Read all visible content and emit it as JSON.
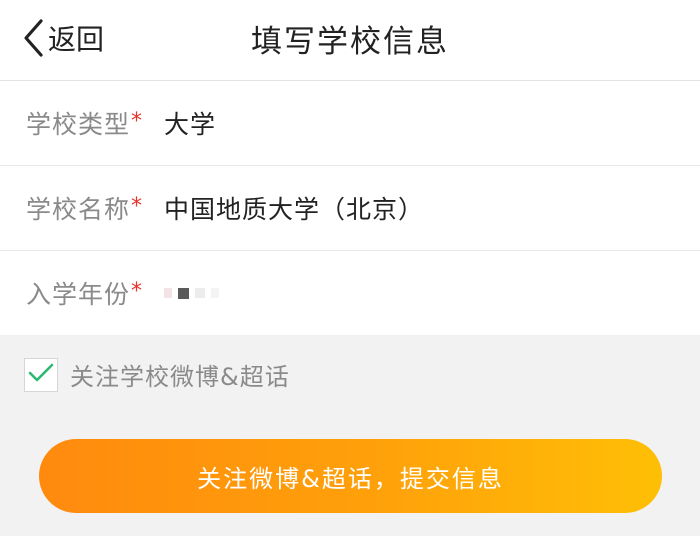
{
  "navbar": {
    "back_label": "返回",
    "title": "填写学校信息"
  },
  "form": {
    "rows": [
      {
        "label": "学校类型",
        "required_mark": "*",
        "value": "大学"
      },
      {
        "label": "学校名称",
        "required_mark": "*",
        "value": "中国地质大学（北京）"
      },
      {
        "label": "入学年份",
        "required_mark": "*",
        "value": ""
      }
    ]
  },
  "follow_checkbox": {
    "checked": true,
    "label": "关注学校微博&超话"
  },
  "submit": {
    "label": "关注微博&超话，提交信息"
  },
  "colors": {
    "accent_start": "#ff8a0e",
    "accent_end": "#ffbf06",
    "required_mark": "#e5322d",
    "check_green": "#2eb872",
    "label_gray": "#8a8a8a"
  },
  "icons": {
    "back": "chevron-left-icon",
    "check": "checkmark-icon"
  }
}
